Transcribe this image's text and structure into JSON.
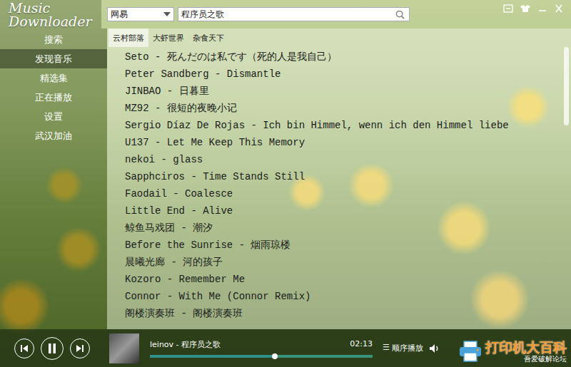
{
  "logo": "Music Downloader",
  "source": {
    "value": "网易"
  },
  "search": {
    "value": "程序员之歌"
  },
  "sidebar": {
    "items": [
      {
        "label": "搜索",
        "selected": false
      },
      {
        "label": "发现音乐",
        "selected": true
      },
      {
        "label": "精选集",
        "selected": false
      },
      {
        "label": "正在播放",
        "selected": false
      },
      {
        "label": "设置",
        "selected": false
      },
      {
        "label": "武汉加油",
        "selected": false
      }
    ]
  },
  "tabs": [
    {
      "label": "云村部落",
      "selected": true
    },
    {
      "label": "大虾世界",
      "selected": false
    },
    {
      "label": "杂食天下",
      "selected": false
    }
  ],
  "songs": [
    "Seto - 死んだのは私です（死的人是我自己）",
    "Peter Sandberg - Dismantle",
    "JINBAO - 日暮里",
    "MZ92 - 很短的夜晚小记",
    "Sergio Díaz De Rojas - Ich bin Himmel, wenn ich den Himmel liebe",
    "U137 - Let Me Keep This Memory",
    "nekoi - glass",
    "Sapphciros - Time Stands Still",
    "Faodail - Coalesce",
    "Little End - Alive",
    "鲸鱼马戏团 - 潮汐",
    "Before the Sunrise - 烟雨琼楼",
    "晨曦光廊 - 河的孩子",
    "Kozoro - Remember Me",
    "Connor - With Me (Connor Remix)",
    "阁楼演奏班 - 阁楼演奏班"
  ],
  "scrollbar": {
    "level": 0
  },
  "player": {
    "track": "leinov - 程序员之歌",
    "time": "02:13",
    "level": 0.56,
    "playing": true,
    "mode_icon": "☰",
    "mode": "顺序播放"
  },
  "watermark": {
    "title": "打印机大百科",
    "subtitle": "吾爱破解论坛"
  }
}
